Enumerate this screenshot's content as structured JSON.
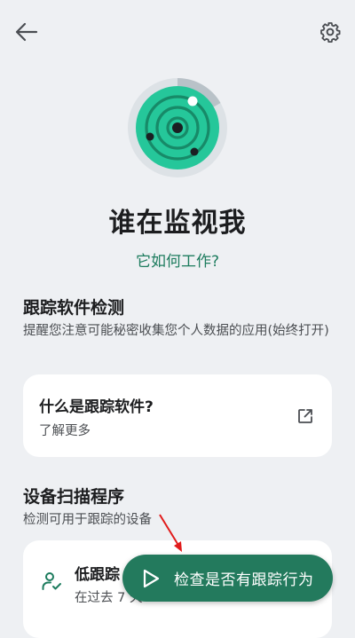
{
  "title": "谁在监视我",
  "how_it_works_link": "它如何工作?",
  "tracking_section": {
    "heading": "跟踪软件检测",
    "description": "提醒您注意可能秘密收集您个人数据的应用(始终打开)",
    "card": {
      "title": "什么是跟踪软件?",
      "subtitle": "了解更多"
    }
  },
  "scanner_section": {
    "heading": "设备扫描程序",
    "description": "检测可用于跟踪的设备",
    "card": {
      "title": "低跟踪",
      "subtitle": "在过去 7 天"
    }
  },
  "fab": {
    "label": "检查是否有跟踪行为"
  },
  "icons": {
    "back": "arrow-left-icon",
    "settings": "gear-icon",
    "radar": "radar-illustration",
    "external": "external-link-icon",
    "user_check": "user-check-icon",
    "play": "play-icon"
  },
  "colors": {
    "background": "#eef0f3",
    "accent": "#237a5d",
    "link": "#1d7c5e",
    "radar_green": "#25c79a"
  }
}
